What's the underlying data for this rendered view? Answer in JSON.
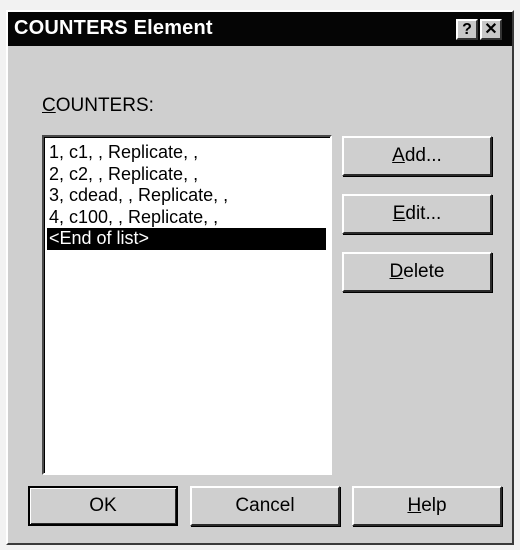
{
  "dialog": {
    "title": "COUNTERS Element",
    "help_glyph": "?",
    "close_glyph": "✕"
  },
  "counters": {
    "label_accel": "C",
    "label_rest": "OUNTERS:",
    "items": [
      "1, c1, , Replicate, ,",
      "2, c2, , Replicate, ,",
      "3, cdead, , Replicate, ,",
      "4, c100, , Replicate, ,",
      "<End of list>"
    ],
    "selected_index": 4
  },
  "buttons": {
    "add": {
      "accel": "A",
      "rest": "dd..."
    },
    "edit": {
      "accel": "E",
      "rest": "dit..."
    },
    "delete": {
      "accel": "D",
      "rest": "elete"
    },
    "ok": "OK",
    "cancel": "Cancel",
    "help": {
      "accel": "H",
      "rest": "elp"
    }
  }
}
